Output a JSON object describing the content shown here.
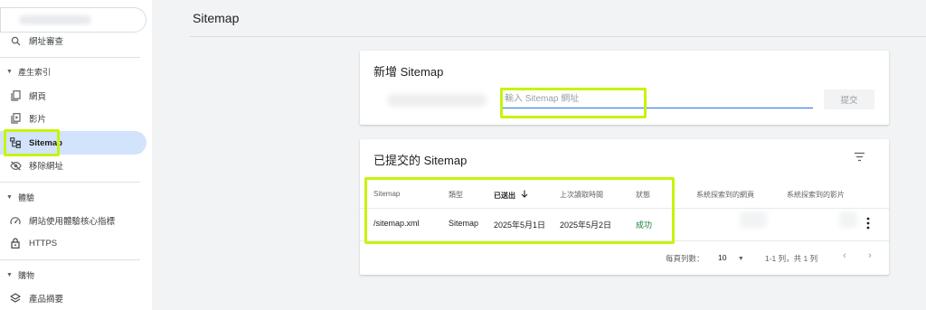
{
  "sidebar": {
    "url_inspection": "網址審查",
    "indexing": {
      "section": "產生索引",
      "items": [
        "網頁",
        "影片",
        "Sitemap",
        "移除網址"
      ]
    },
    "experience": {
      "section": "體驗",
      "items": [
        "網站使用體驗核心指標",
        "HTTPS"
      ]
    },
    "shopping": {
      "section": "購物",
      "items": [
        "產品摘要"
      ]
    },
    "active_item": "Sitemap"
  },
  "header": {
    "title": "Sitemap"
  },
  "add_sitemap": {
    "title": "新增 Sitemap",
    "input_placeholder": "輸入 Sitemap 網址",
    "submit_label": "提交"
  },
  "submitted": {
    "title": "已提交的 Sitemap",
    "columns": [
      "Sitemap",
      "類型",
      "已送出",
      "上次讀取時間",
      "狀態",
      "系統探索到的網頁",
      "系統探索到的影片"
    ],
    "sorted_column": "已送出",
    "rows": [
      {
        "sitemap": "/sitemap.xml",
        "type": "Sitemap",
        "submitted": "2025年5月1日",
        "last_read": "2025年5月2日",
        "status": "成功"
      }
    ],
    "rows_per_page_label": "每頁列數：",
    "rows_per_page": "10",
    "range": "1-1 列，共 1 列"
  },
  "colors": {
    "highlight": "#c6f40c",
    "active_nav": "#d2e3fc",
    "success": "#188038",
    "accent": "#1a73e8"
  }
}
